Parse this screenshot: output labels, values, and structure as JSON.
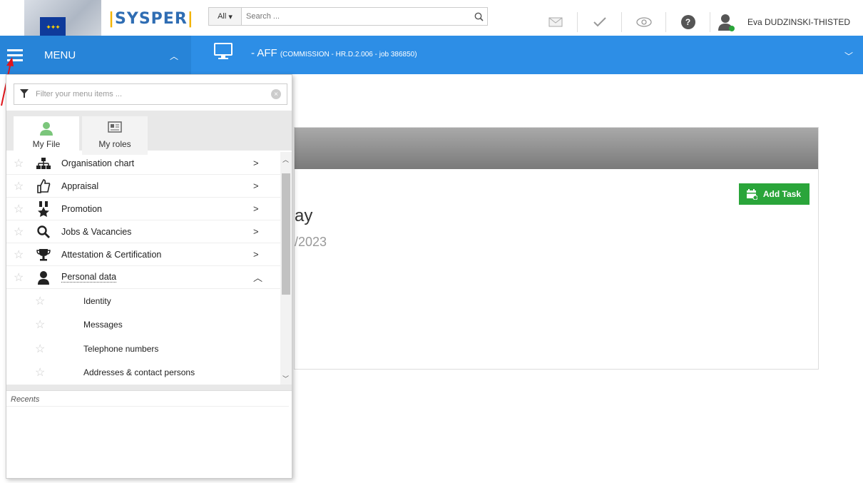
{
  "topbar": {
    "brand": "SYSPER",
    "search": {
      "scope": "All",
      "placeholder": "Search ..."
    },
    "user_name": "Eva DUDZINSKI-THISTED"
  },
  "bluebar": {
    "menu_label": "MENU",
    "title_main": "- AFF",
    "title_detail": "(COMMISSION - HR.D.2.006 - job 386850)"
  },
  "menu_panel": {
    "filter_placeholder": "Filter your menu items ...",
    "tabs": [
      {
        "label": "My File"
      },
      {
        "label": "My roles"
      }
    ],
    "items": [
      {
        "label": "Organisation chart",
        "icon": "organisation-chart-icon"
      },
      {
        "label": "Appraisal",
        "icon": "thumbs-up-icon"
      },
      {
        "label": "Promotion",
        "icon": "medal-icon"
      },
      {
        "label": "Jobs & Vacancies",
        "icon": "magnifier-icon"
      },
      {
        "label": "Attestation & Certification",
        "icon": "trophy-icon"
      },
      {
        "label": "Personal data",
        "icon": "person-icon",
        "expanded": true
      }
    ],
    "sub_items": [
      {
        "label": "Identity"
      },
      {
        "label": "Messages"
      },
      {
        "label": "Telephone numbers"
      },
      {
        "label": "Addresses & contact persons"
      }
    ],
    "recents_label": "Recents"
  },
  "content": {
    "add_task_label": "Add Task",
    "title_fragment": "ay",
    "date_fragment": "/2023"
  },
  "colors": {
    "blue": "#2d8ee6",
    "green": "#2aa53a",
    "brand_blue": "#2f6db3",
    "brand_yellow": "#f3b400"
  }
}
